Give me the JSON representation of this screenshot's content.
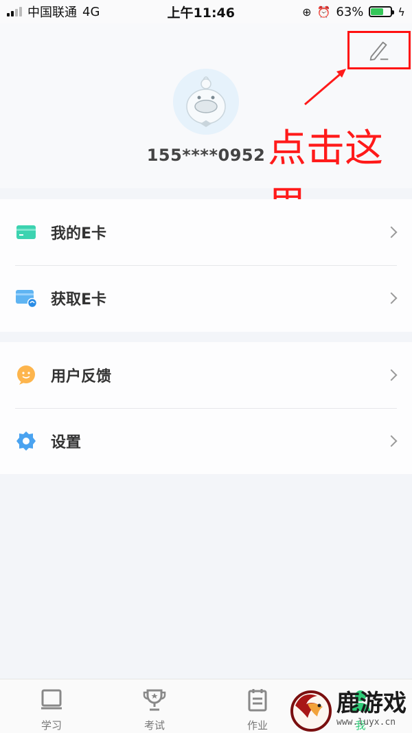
{
  "status_bar": {
    "carrier": "中国联通",
    "network": "4G",
    "time": "上午11:46",
    "battery": "63%",
    "battery_level": 0.63
  },
  "profile": {
    "phone": "155****0952"
  },
  "annotation": {
    "text": "点击这里",
    "color": "#ff1a1a"
  },
  "menu": {
    "group1": [
      {
        "label": "我的E卡",
        "icon": "card-icon"
      },
      {
        "label": "获取E卡",
        "icon": "get-card-icon"
      }
    ],
    "group2": [
      {
        "label": "用户反馈",
        "icon": "feedback-icon"
      },
      {
        "label": "设置",
        "icon": "settings-icon"
      }
    ]
  },
  "tabs": [
    {
      "label": "学习",
      "icon": "book-icon"
    },
    {
      "label": "考试",
      "icon": "trophy-icon"
    },
    {
      "label": "作业",
      "icon": "notepad-icon"
    },
    {
      "label": "我",
      "icon": "person-icon"
    }
  ],
  "watermark": {
    "title": "鹿游戏",
    "url": "www.luyx.cn"
  }
}
